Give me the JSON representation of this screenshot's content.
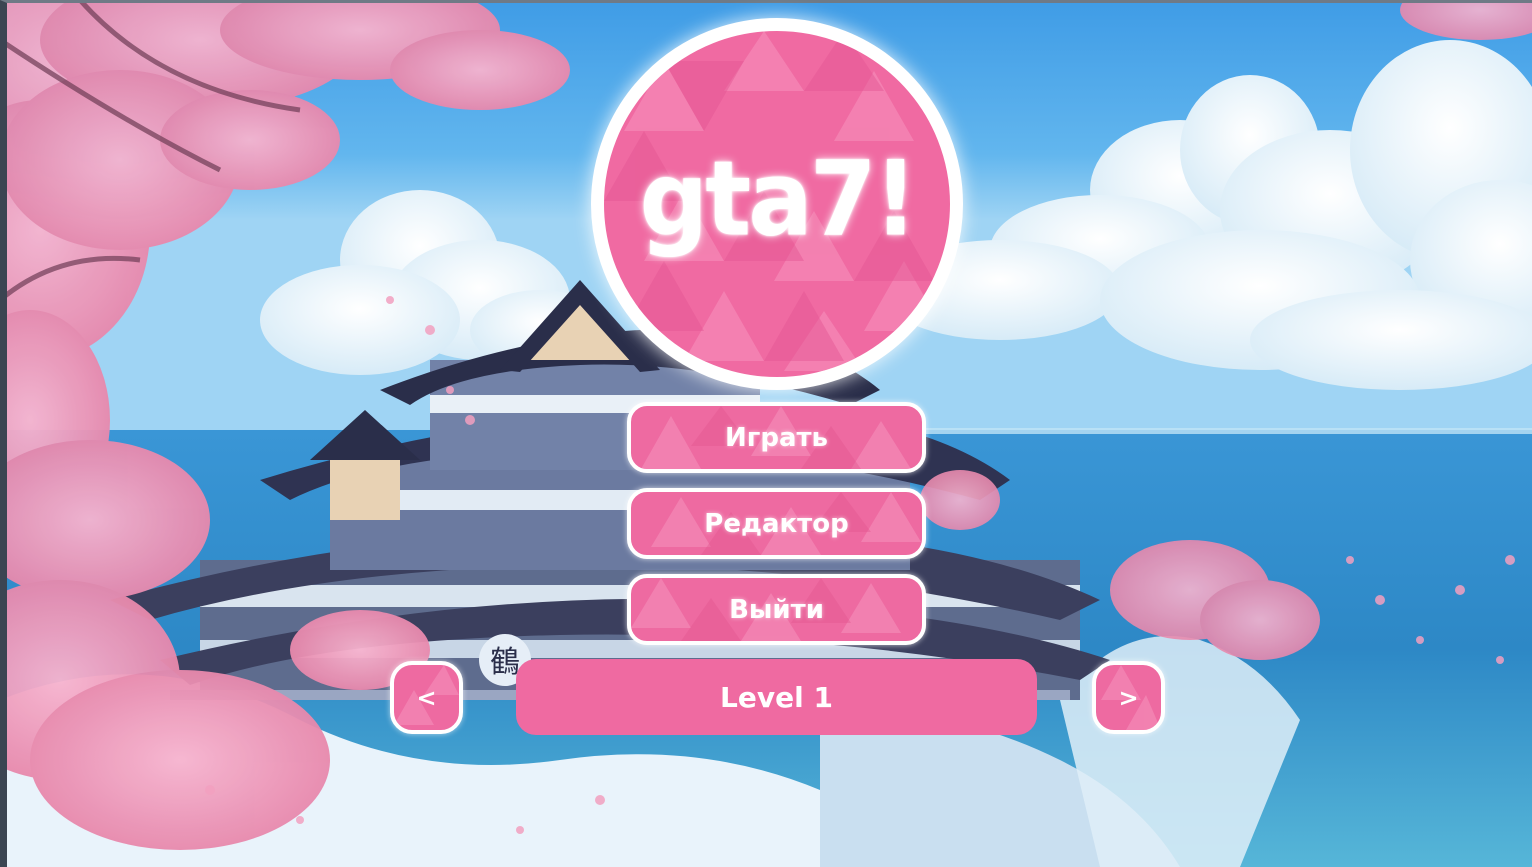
{
  "logo": {
    "text": "gta7!"
  },
  "menu": {
    "play_label": "Играть",
    "editor_label": "Редактор",
    "exit_label": "Выйти"
  },
  "level_selector": {
    "prev_label": "<",
    "current_level": "Level 1",
    "next_label": ">"
  },
  "colors": {
    "accent_pink": "#ee6aa1",
    "outline": "#ffffff",
    "sky": "#4aa6e6",
    "sea": "#2f86c8"
  },
  "icons": {
    "background": "anime-pagoda-sakura-scene"
  }
}
